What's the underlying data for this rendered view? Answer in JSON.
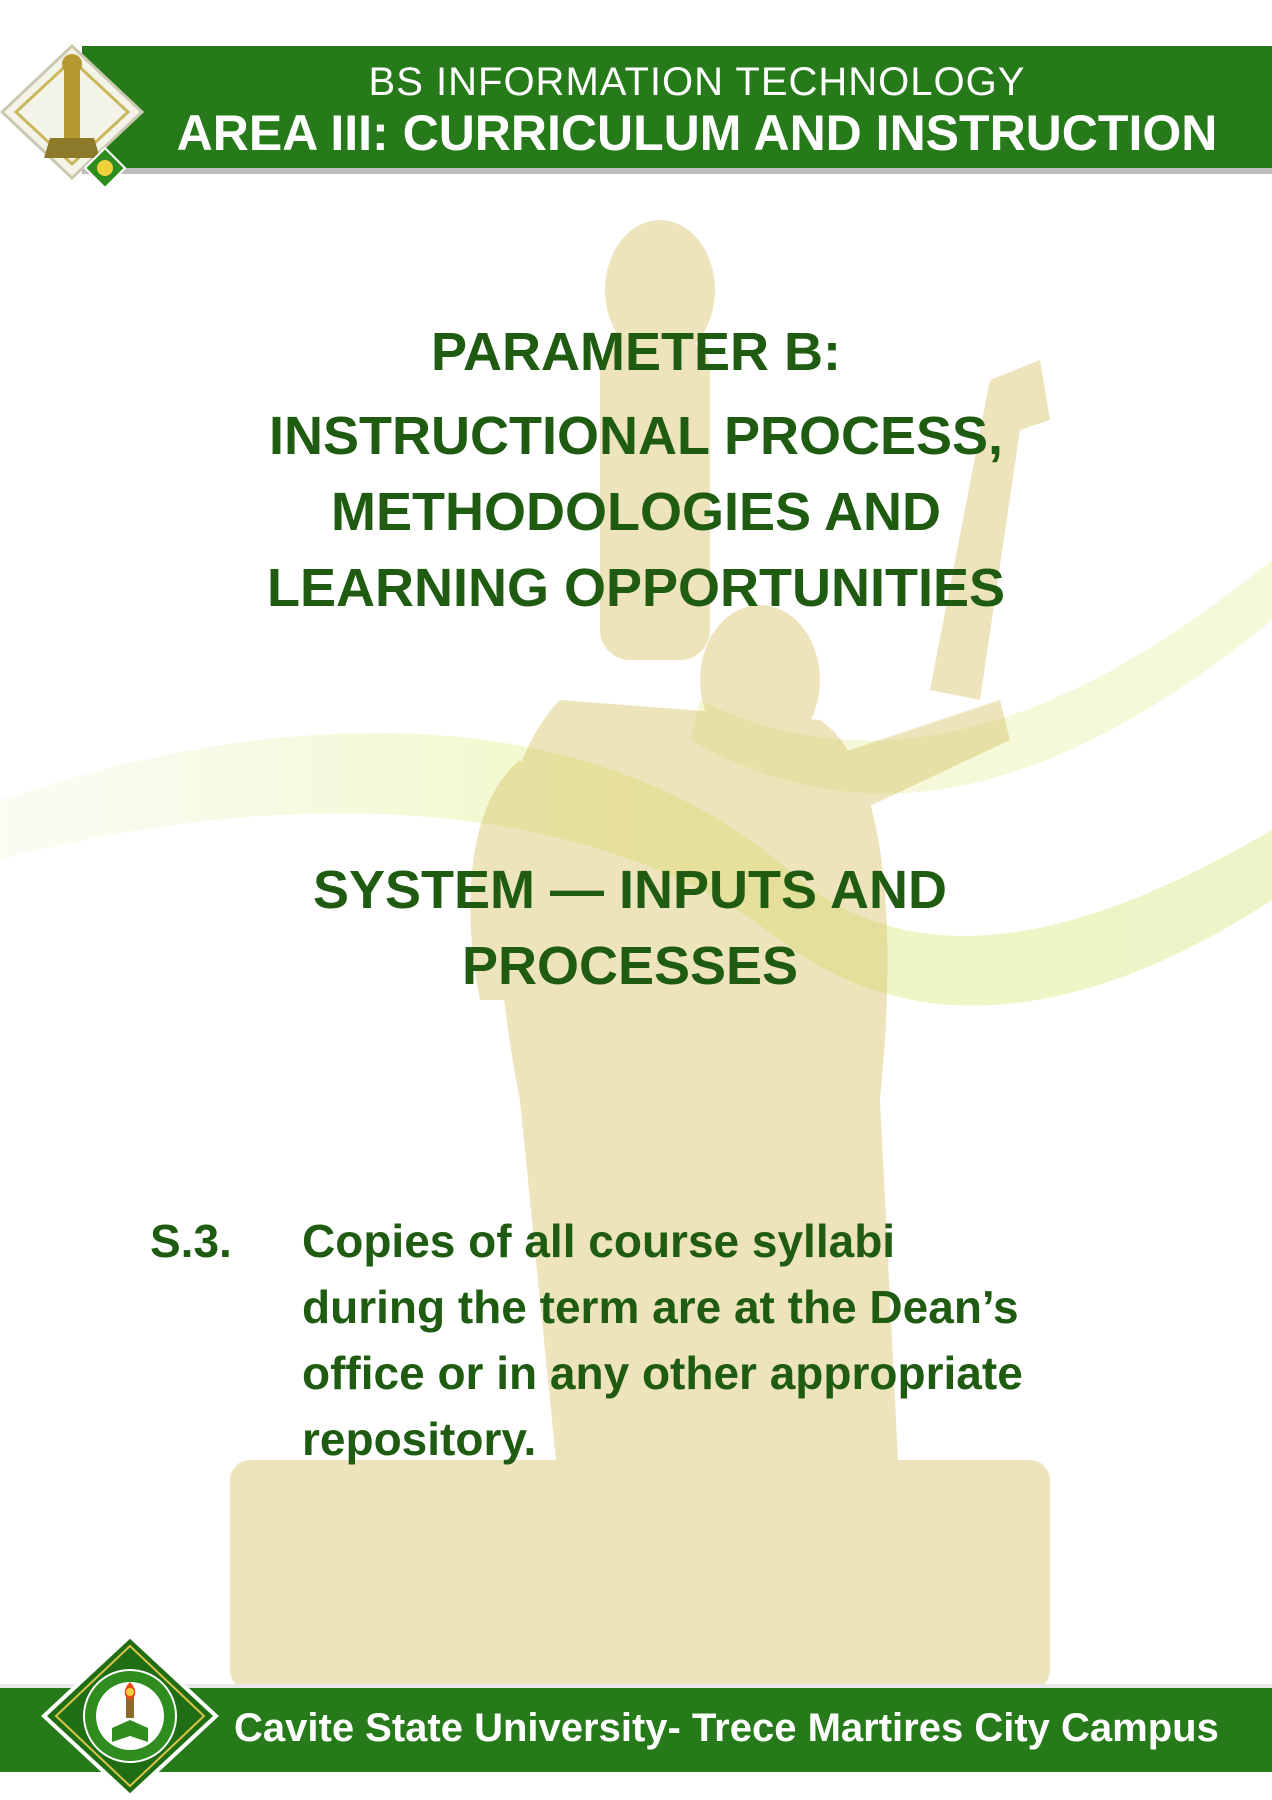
{
  "header": {
    "program": "BS INFORMATION TECHNOLOGY",
    "area": "AREA III: CURRICULUM AND INSTRUCTION",
    "logo_icon": "monument-logo-icon"
  },
  "parameter": {
    "title": "PARAMETER B:",
    "description_lines": [
      "INSTRUCTIONAL  PROCESS,",
      "METHODOLOGIES AND",
      "LEARNING OPPORTUNITIES"
    ]
  },
  "section": {
    "lines": [
      "SYSTEM — INPUTS AND",
      "PROCESSES"
    ]
  },
  "item": {
    "code": "S.3.",
    "text_lines": [
      "Copies of all course syllabi",
      "during the term are at the Dean’s",
      "office or in any other appropriate",
      "repository."
    ]
  },
  "footer": {
    "campus": "Cavite State University- Trece Martires City Campus",
    "seal_icon": "university-seal-icon"
  },
  "colors": {
    "band_green": "#267a1a",
    "text_green": "#1f5c12",
    "watermark_gold": "#d8c46a"
  }
}
